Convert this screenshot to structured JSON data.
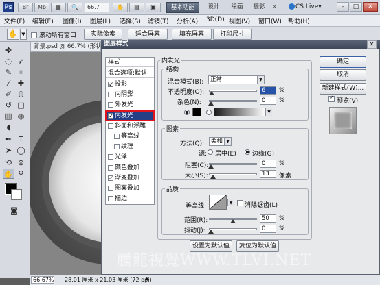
{
  "app": {
    "logo_text": "Ps",
    "zoom": "66.7",
    "workspaces": [
      "基本功能",
      "设计",
      "绘画",
      "摄影",
      "»"
    ],
    "cs_live": "CS Live▾"
  },
  "menu": [
    "文件(F)",
    "编辑(E)",
    "图像(I)",
    "图层(L)",
    "选择(S)",
    "滤镜(T)",
    "分析(A)",
    "3D(D)",
    "视图(V)",
    "窗口(W)",
    "帮助(H)"
  ],
  "options": {
    "scroll_all": "滚动所有窗口",
    "actual_pixels": "实际像素",
    "fit_screen": "适合屏幕",
    "fill_screen": "填充屏幕",
    "print_size": "打印尺寸"
  },
  "document": {
    "tab_title": "背景.psd @ 66.7% (形状",
    "status_zoom": "66.67%",
    "status_dims": "28.01 厘米 x 21.03 厘米 (72 ppi)"
  },
  "dialog": {
    "title": "图层样式",
    "styles_header": "样式",
    "blend_options": "混合选项:默认",
    "styles": [
      {
        "label": "投影",
        "checked": true
      },
      {
        "label": "内阴影",
        "checked": false
      },
      {
        "label": "外发光",
        "checked": false
      },
      {
        "label": "内发光",
        "checked": true,
        "selected": true
      },
      {
        "label": "斜面和浮雕",
        "checked": false
      },
      {
        "label": "等高线",
        "checked": false,
        "sub": true
      },
      {
        "label": "纹理",
        "checked": false,
        "sub": true
      },
      {
        "label": "光泽",
        "checked": false
      },
      {
        "label": "颜色叠加",
        "checked": false
      },
      {
        "label": "渐变叠加",
        "checked": true
      },
      {
        "label": "图案叠加",
        "checked": false
      },
      {
        "label": "描边",
        "checked": false
      }
    ],
    "panel_title": "内发光",
    "structure": {
      "title": "结构",
      "blend_mode_label": "混合模式(B):",
      "blend_mode_value": "正常",
      "opacity_label": "不透明度(O):",
      "opacity_value": "6",
      "noise_label": "杂色(N):",
      "noise_value": "0",
      "percent": "%"
    },
    "elements": {
      "title": "图素",
      "method_label": "方法(Q):",
      "method_value": "柔和",
      "source_label": "源:",
      "center_label": "居中(E)",
      "edge_label": "边缘(G)",
      "choke_label": "阻塞(C):",
      "choke_value": "0",
      "size_label": "大小(S):",
      "size_value": "13",
      "px": "像素"
    },
    "quality": {
      "title": "品质",
      "contour_label": "等高线:",
      "antialias_label": "消除锯齿(L)",
      "range_label": "范围(R):",
      "range_value": "50",
      "jitter_label": "抖动(J):",
      "jitter_value": "0"
    },
    "make_default": "设置为默认值",
    "reset_default": "复位为默认值",
    "ok": "确定",
    "cancel": "取消",
    "new_style": "新建样式(W)...",
    "preview": "预览(V)"
  },
  "watermark": "騰龍視覺WWW.TLVI.NET",
  "colors": {
    "selected_row": "#243f86",
    "highlight_outline": "#e1141e",
    "dialog_title": "#3d4657"
  }
}
